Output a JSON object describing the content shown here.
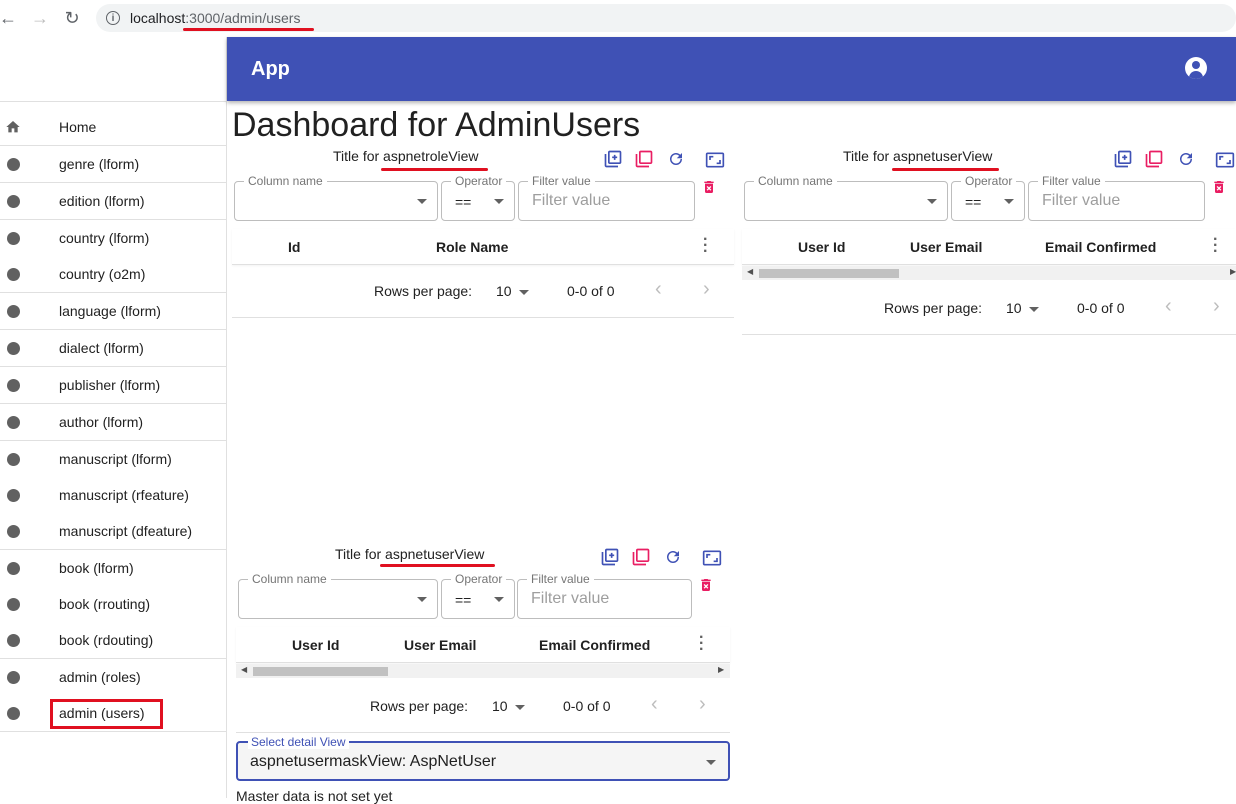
{
  "browser": {
    "back": "←",
    "forward": "→",
    "reload": "↻",
    "url_host": "localhost",
    "url_path": ":3000/admin/users"
  },
  "app": {
    "title": "App"
  },
  "sidebar": {
    "items": [
      {
        "label": "Home"
      },
      {
        "label": "genre (lform)"
      },
      {
        "label": "edition (lform)"
      },
      {
        "label": "country (lform)"
      },
      {
        "label": "country (o2m)"
      },
      {
        "label": "language (lform)"
      },
      {
        "label": "dialect (lform)"
      },
      {
        "label": "publisher (lform)"
      },
      {
        "label": "author (lform)"
      },
      {
        "label": "manuscript (lform)"
      },
      {
        "label": "manuscript (rfeature)"
      },
      {
        "label": "manuscript (dfeature)"
      },
      {
        "label": "book (lform)"
      },
      {
        "label": "book (rrouting)"
      },
      {
        "label": "book (rdouting)"
      },
      {
        "label": "admin (roles)"
      },
      {
        "label": "admin (users)"
      }
    ]
  },
  "page": {
    "title": "Dashboard for AdminUsers"
  },
  "filter": {
    "column_label": "Column name",
    "operator_label": "Operator",
    "operator_value": "==",
    "value_label": "Filter value",
    "value_placeholder": "Filter value"
  },
  "pager": {
    "rows_per_page_label": "Rows per page:",
    "rows_per_page": "10",
    "range": "0-0 of 0",
    "prev": "‹",
    "next": "›"
  },
  "panels": {
    "role": {
      "title_prefix": "Title for ",
      "title_name": "aspnetroleView",
      "columns": [
        "Id",
        "Role Name"
      ]
    },
    "user_top": {
      "title_prefix": "Title for ",
      "title_name": "aspnetuserView",
      "columns": [
        "User Id",
        "User Email",
        "Email Confirmed"
      ]
    },
    "user_bottom": {
      "title_prefix": "Title for ",
      "title_name": "aspnetuserView",
      "columns": [
        "User Id",
        "User Email",
        "Email Confirmed"
      ]
    }
  },
  "detail": {
    "label": "Select detail View",
    "value": "aspnetusermaskView: AspNetUser",
    "note": "Master data is not set yet"
  },
  "colors": {
    "primary": "#3f51b5",
    "accent": "#e91e63",
    "annotation": "#e01020"
  }
}
